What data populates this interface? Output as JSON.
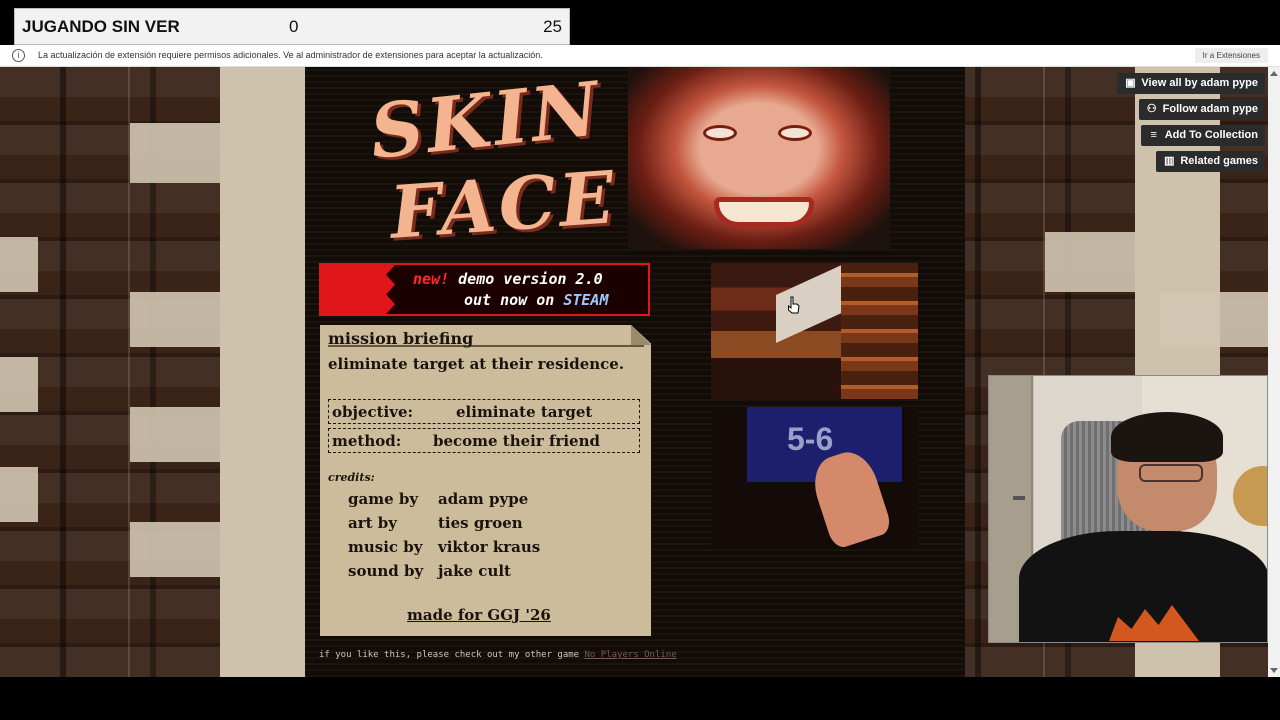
{
  "scorebar": {
    "title": "JUGANDO SIN VER",
    "score_left": "0",
    "score_right": "25"
  },
  "notice": {
    "message": "La actualización de extensión requiere permisos adicionales. Ve al administrador de extensiones para aceptar la actualización.",
    "button": "Ir a Extensiones"
  },
  "game": {
    "logo_line1": "SKIN",
    "logo_line2": "FACE",
    "banner": {
      "new": "new!",
      "line1": "demo version 2.0",
      "line2_prefix": "out now on",
      "steam": "STEAM"
    },
    "briefing": {
      "heading": "mission briefing",
      "description": "eliminate target at their residence.",
      "objective_label": "objective:",
      "objective_value": "eliminate target",
      "method_label": "method:",
      "method_value": "become their friend",
      "credits_heading": "credits:",
      "credits": [
        {
          "role": "game by",
          "name": "adam pype"
        },
        {
          "role": "art by",
          "name": "ties groen"
        },
        {
          "role": "music by",
          "name": "viktor kraus"
        },
        {
          "role": "sound by",
          "name": "jake cult"
        }
      ],
      "made_for": "made for GGJ '26"
    },
    "screenshot2_text": "5-6",
    "footer_text": "if you like this, please check out my other game",
    "footer_link": "No Players Online"
  },
  "itch_buttons": [
    {
      "label": "View all by adam pype",
      "icon": "collection-icon"
    },
    {
      "label": "Follow adam pype",
      "icon": "add-user-icon"
    },
    {
      "label": "Add To Collection",
      "icon": "playlist-add-icon"
    },
    {
      "label": "Related games",
      "icon": "map-icon"
    }
  ]
}
